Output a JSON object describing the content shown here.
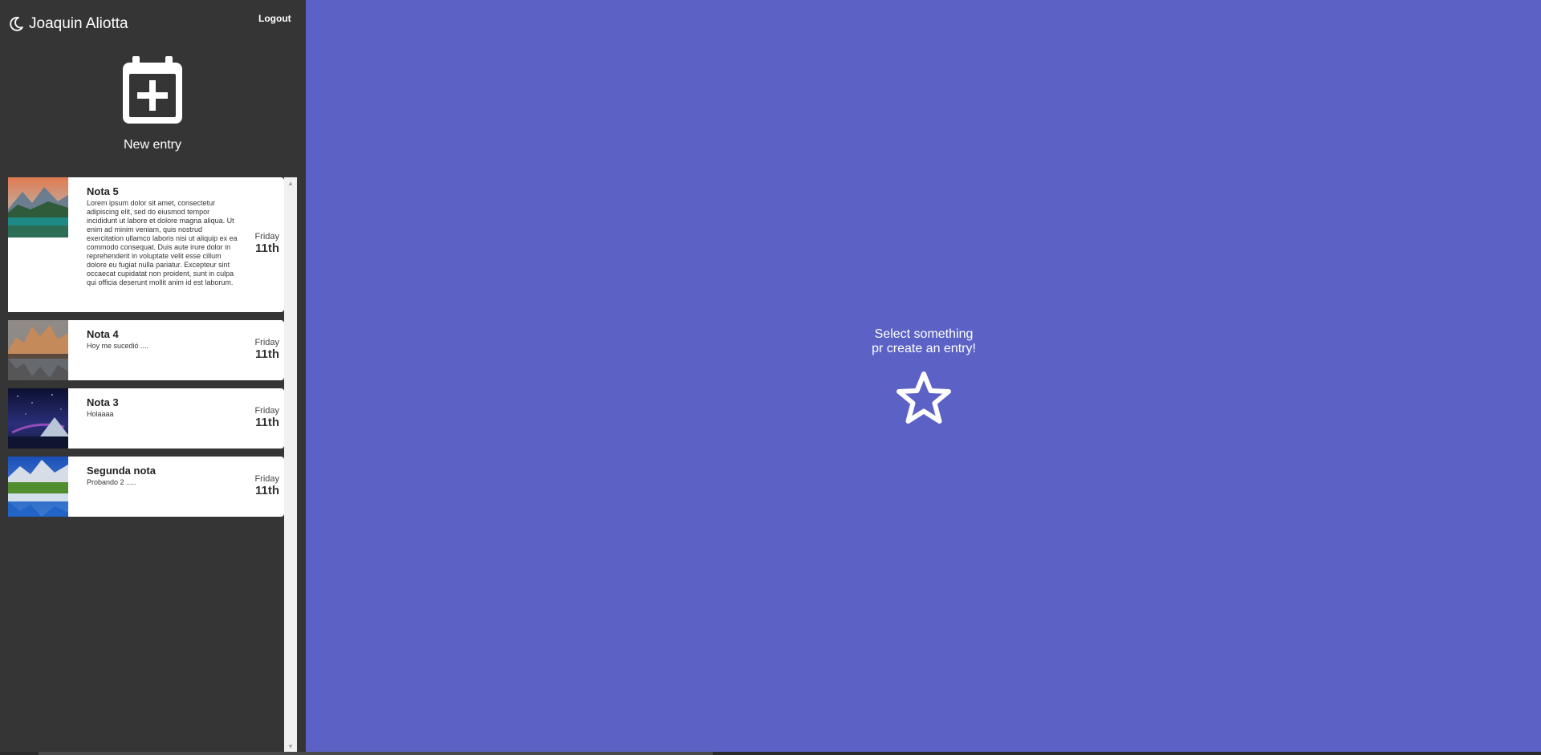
{
  "navbar": {
    "user_name": "Joaquin Aliotta",
    "logout_label": "Logout"
  },
  "new_entry": {
    "label": "New entry",
    "icon": "calendar-plus-icon"
  },
  "entries": [
    {
      "title": "Nota 5",
      "content": "Lorem ipsum dolor sit amet, consectetur adipiscing elit, sed do eiusmod tempor incididunt ut labore et dolore magna aliqua. Ut enim ad minim veniam, quis nostrud exercitation ullamco laboris nisi ut aliquip ex ea commodo consequat. Duis aute irure dolor in reprehenderit in voluptate velit esse cillum dolore eu fugiat nulla pariatur. Excepteur sint occaecat cupidatat non proident, sunt in culpa qui officia deserunt mollit anim id est laborum.",
      "day": "Friday",
      "date": "11th",
      "image": "lake-mountain-sunset"
    },
    {
      "title": "Nota 4",
      "content": "Hoy me sucedió ....",
      "day": "Friday",
      "date": "11th",
      "image": "mountain-reflection"
    },
    {
      "title": "Nota 3",
      "content": "Holaaaa",
      "day": "Friday",
      "date": "11th",
      "image": "night-sky-mountain"
    },
    {
      "title": "Segunda nota",
      "content": "Probando 2 .....",
      "day": "Friday",
      "date": "11th",
      "image": "alpine-lake"
    }
  ],
  "nothing_selected": {
    "line1": "Select something",
    "line2": "pr create an entry!",
    "icon": "star-icon"
  },
  "colors": {
    "sidebar_bg": "#353535",
    "main_bg": "#5c62c5",
    "entry_bg": "#ffffff"
  }
}
